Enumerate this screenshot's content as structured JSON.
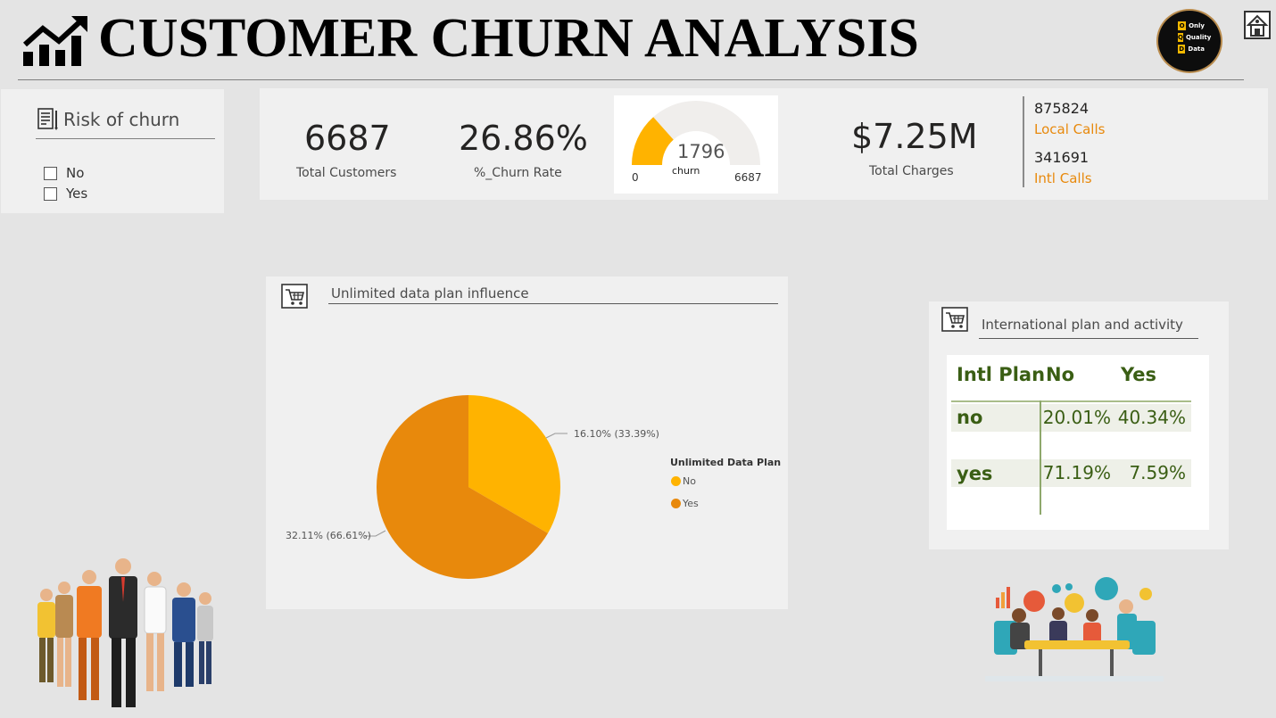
{
  "header": {
    "title": "CUSTOMER CHURN ANALYSIS",
    "icon": "trend-up-chart-icon"
  },
  "logo": {
    "lines": [
      "Only",
      "Quality",
      "Data"
    ],
    "letters": [
      "O",
      "Q",
      "D"
    ]
  },
  "slicer": {
    "title": "Risk of churn",
    "options": [
      {
        "label": "No",
        "checked": false
      },
      {
        "label": "Yes",
        "checked": false
      }
    ]
  },
  "kpis": {
    "total_customers": {
      "value": "6687",
      "label": "Total Customers"
    },
    "churn_rate": {
      "value": "26.86%",
      "label": "%_Churn Rate"
    },
    "gauge": {
      "value": "1796",
      "label": "churn",
      "min": "0",
      "max": "6687",
      "value_num": 1796,
      "max_num": 6687
    },
    "total_charges": {
      "value": "$7.25M",
      "label": "Total Charges"
    },
    "local_calls": {
      "value": "875824",
      "label": "Local Calls"
    },
    "intl_calls": {
      "value": "341691",
      "label": "Intl Calls"
    }
  },
  "pie_section": {
    "title": "Unlimited data plan influence"
  },
  "chart_data": {
    "type": "pie",
    "legend_title": "Unlimited Data Plan",
    "legend_position": "right",
    "slices": [
      {
        "name": "No",
        "value": 16.1,
        "share": 33.39,
        "label": "16.10% (33.39%)",
        "color": "#FFB300"
      },
      {
        "name": "Yes",
        "value": 32.11,
        "share": 66.61,
        "label": "32.11% (66.61%)",
        "color": "#E8890C"
      }
    ]
  },
  "intl_section": {
    "title": "International plan and activity",
    "headers": [
      "Intl Plan",
      "No",
      "Yes"
    ],
    "rows": [
      {
        "label": "no",
        "no": "20.01%",
        "yes": "40.34%"
      },
      {
        "label": "yes",
        "no": "71.19%",
        "yes": "7.59%"
      }
    ]
  },
  "colors": {
    "accent": "#FFB300",
    "accent_dark": "#E8890C",
    "matrix_text": "#3A5E14"
  }
}
